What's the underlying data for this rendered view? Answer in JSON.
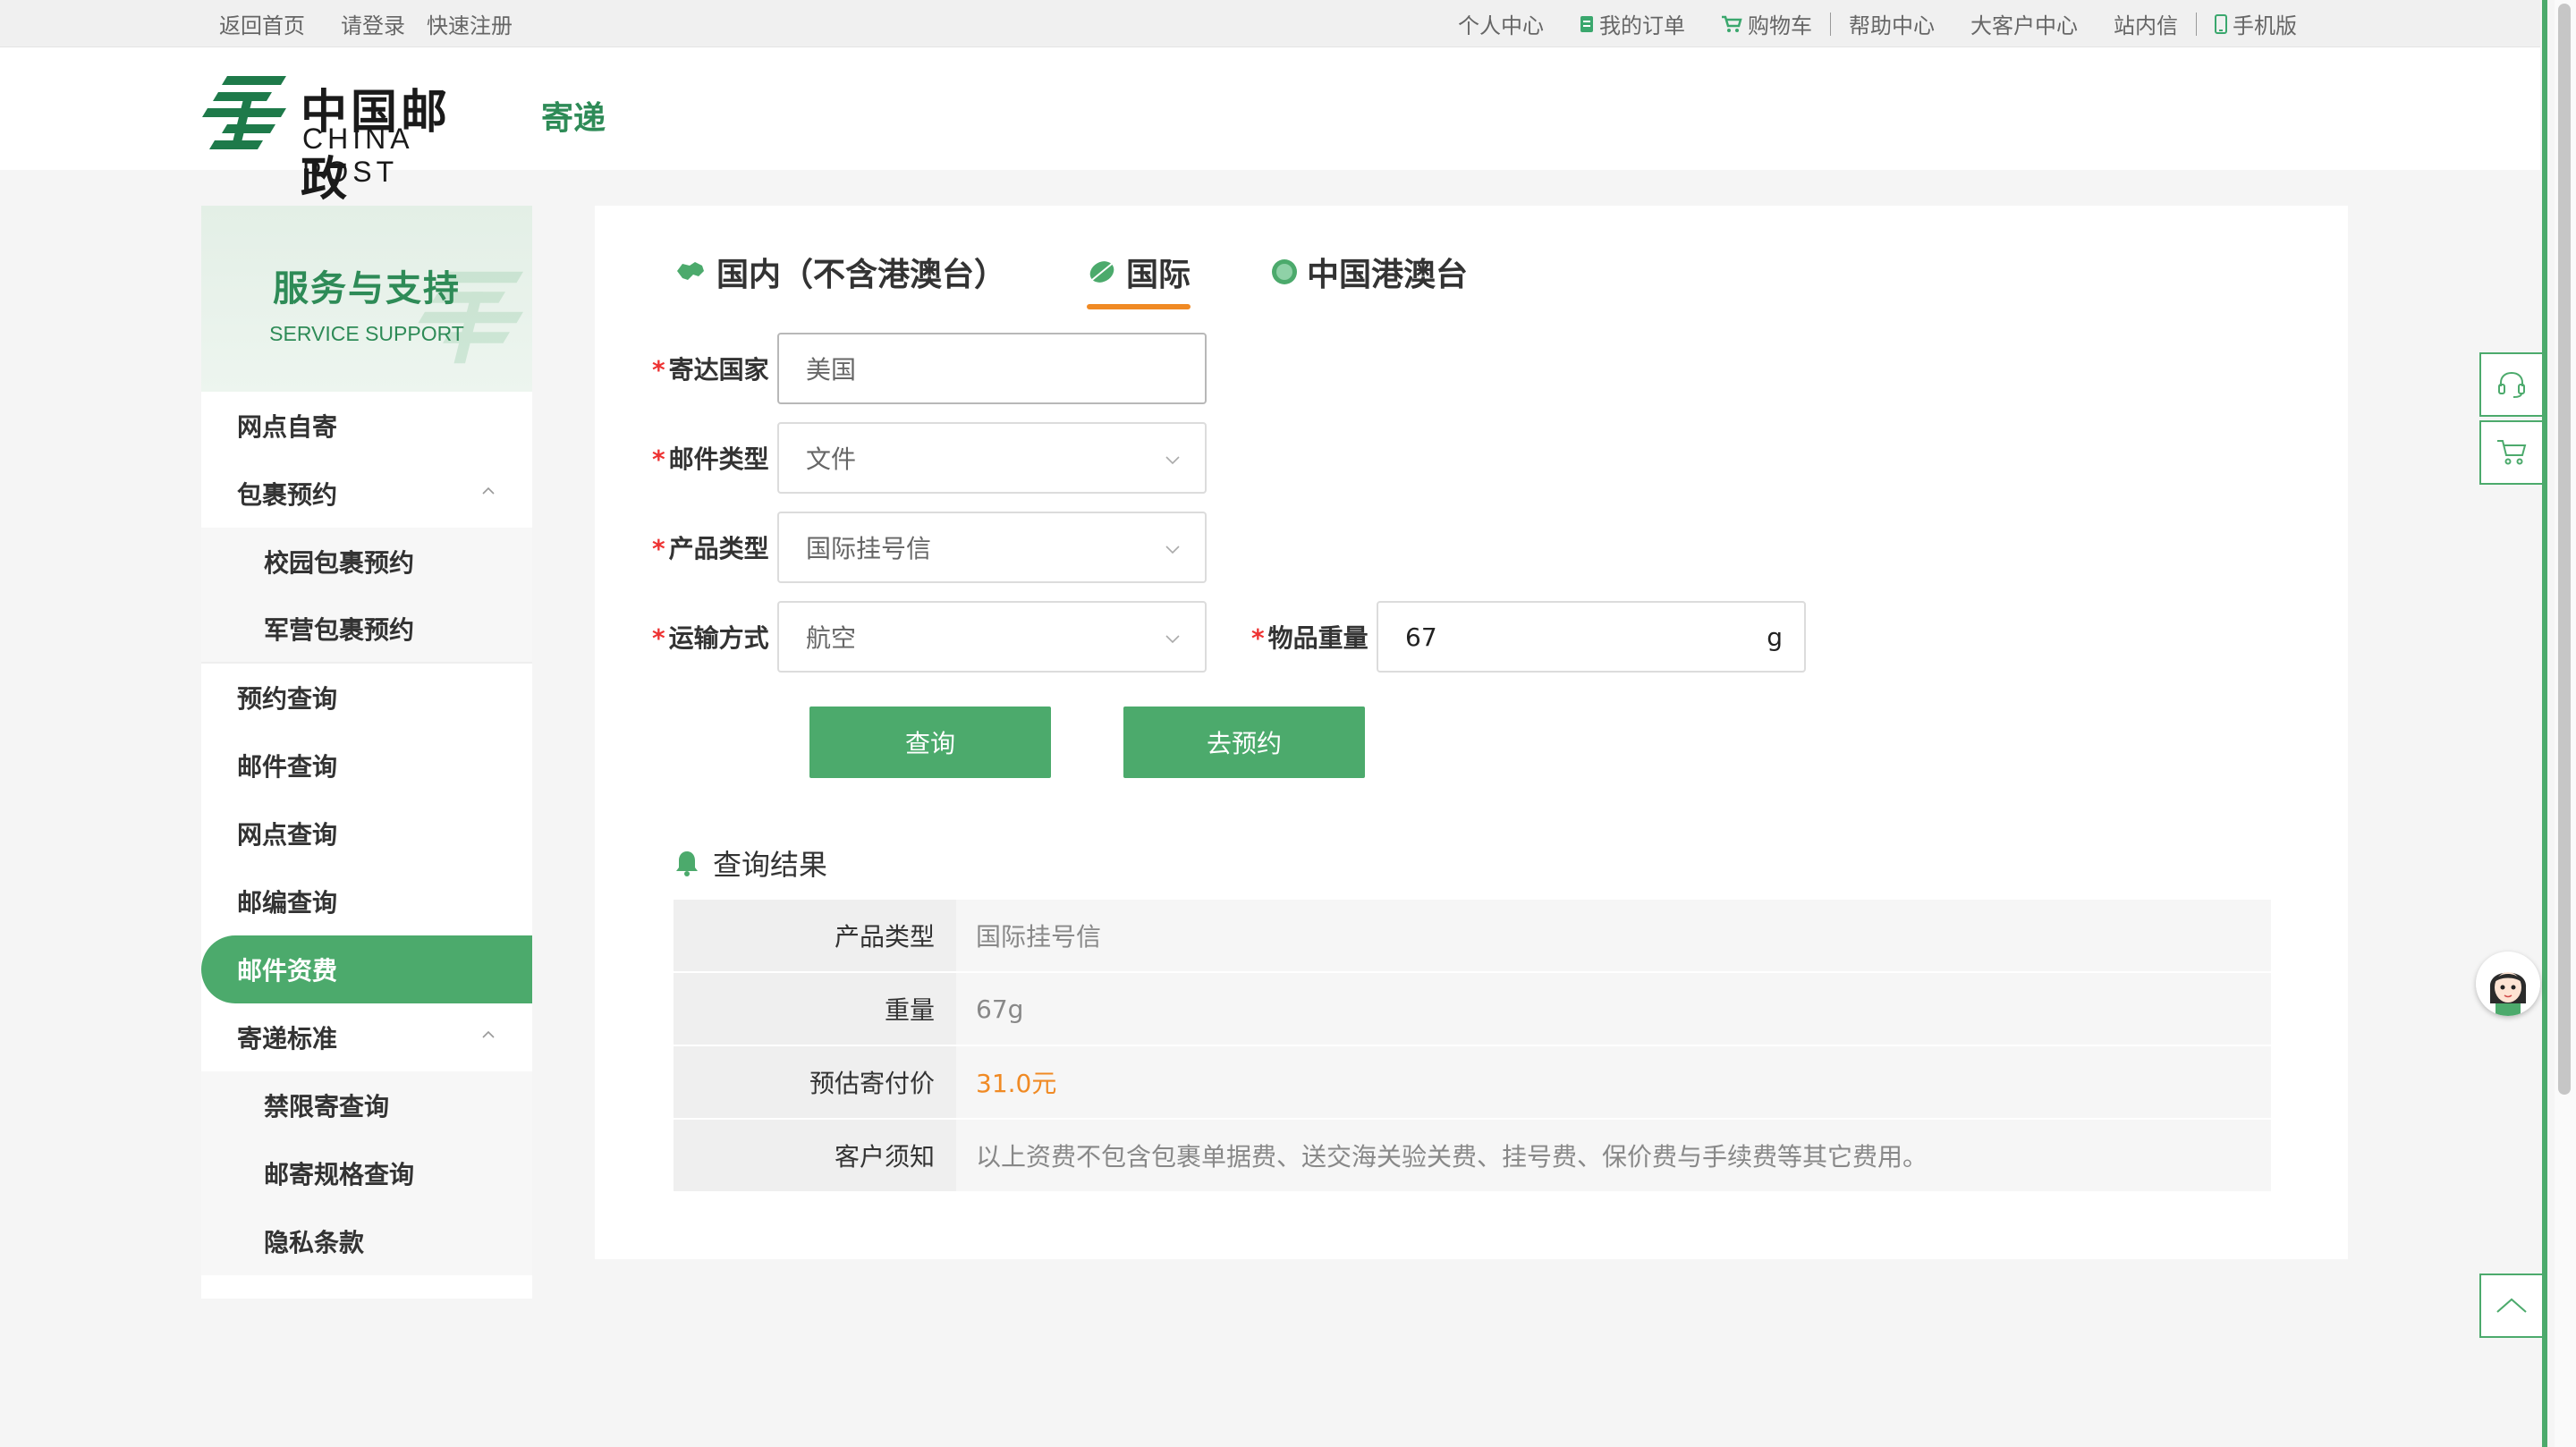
{
  "topbar": {
    "left": [
      "返回首页",
      "请登录",
      "快速注册"
    ],
    "right": [
      {
        "label": "个人中心",
        "icon": ""
      },
      {
        "label": "我的订单",
        "icon": "order-icon"
      },
      {
        "label": "购物车",
        "icon": "cart-icon"
      },
      {
        "label": "帮助中心",
        "icon": ""
      },
      {
        "label": "大客户中心",
        "icon": ""
      },
      {
        "label": "站内信",
        "icon": ""
      },
      {
        "label": "手机版",
        "icon": "mobile-icon"
      }
    ]
  },
  "header": {
    "logo_cn": "中国邮政",
    "logo_en": "CHINA POST",
    "subtitle": "寄递"
  },
  "sidebar": {
    "title": "服务与支持",
    "subtitle": "SERVICE SUPPORT",
    "items": [
      {
        "label": "网点自寄"
      },
      {
        "label": "包裹预约"
      },
      {
        "label": "校园包裹预约"
      },
      {
        "label": "军营包裹预约"
      },
      {
        "label": "预约查询"
      },
      {
        "label": "邮件查询"
      },
      {
        "label": "网点查询"
      },
      {
        "label": "邮编查询"
      },
      {
        "label": "邮件资费"
      },
      {
        "label": "寄递标准"
      },
      {
        "label": "禁限寄查询"
      },
      {
        "label": "邮寄规格查询"
      },
      {
        "label": "隐私条款"
      }
    ]
  },
  "tabs": [
    "国内（不含港澳台）",
    "国际",
    "中国港澳台"
  ],
  "form": {
    "country_label": "寄达国家",
    "country_value": "美国",
    "mail_type_label": "邮件类型",
    "mail_type_value": "文件",
    "product_type_label": "产品类型",
    "product_type_value": "国际挂号信",
    "transport_label": "运输方式",
    "transport_value": "航空",
    "weight_label": "物品重量",
    "weight_value": "67",
    "weight_unit": "g",
    "required_mark": "*"
  },
  "buttons": {
    "query": "查询",
    "book": "去预约"
  },
  "result": {
    "title": "查询结果",
    "rows": [
      {
        "key": "产品类型",
        "value": "国际挂号信"
      },
      {
        "key": "重量",
        "value": "67g"
      },
      {
        "key": "预估寄付价",
        "value": "31.0元"
      },
      {
        "key": "客户须知",
        "value": "以上资费不包含包裹单据费、送交海关验关费、挂号费、保价费与手续费等其它费用。"
      }
    ]
  },
  "colors": {
    "brand_green": "#4caa6c",
    "accent_orange": "#f08a24"
  }
}
